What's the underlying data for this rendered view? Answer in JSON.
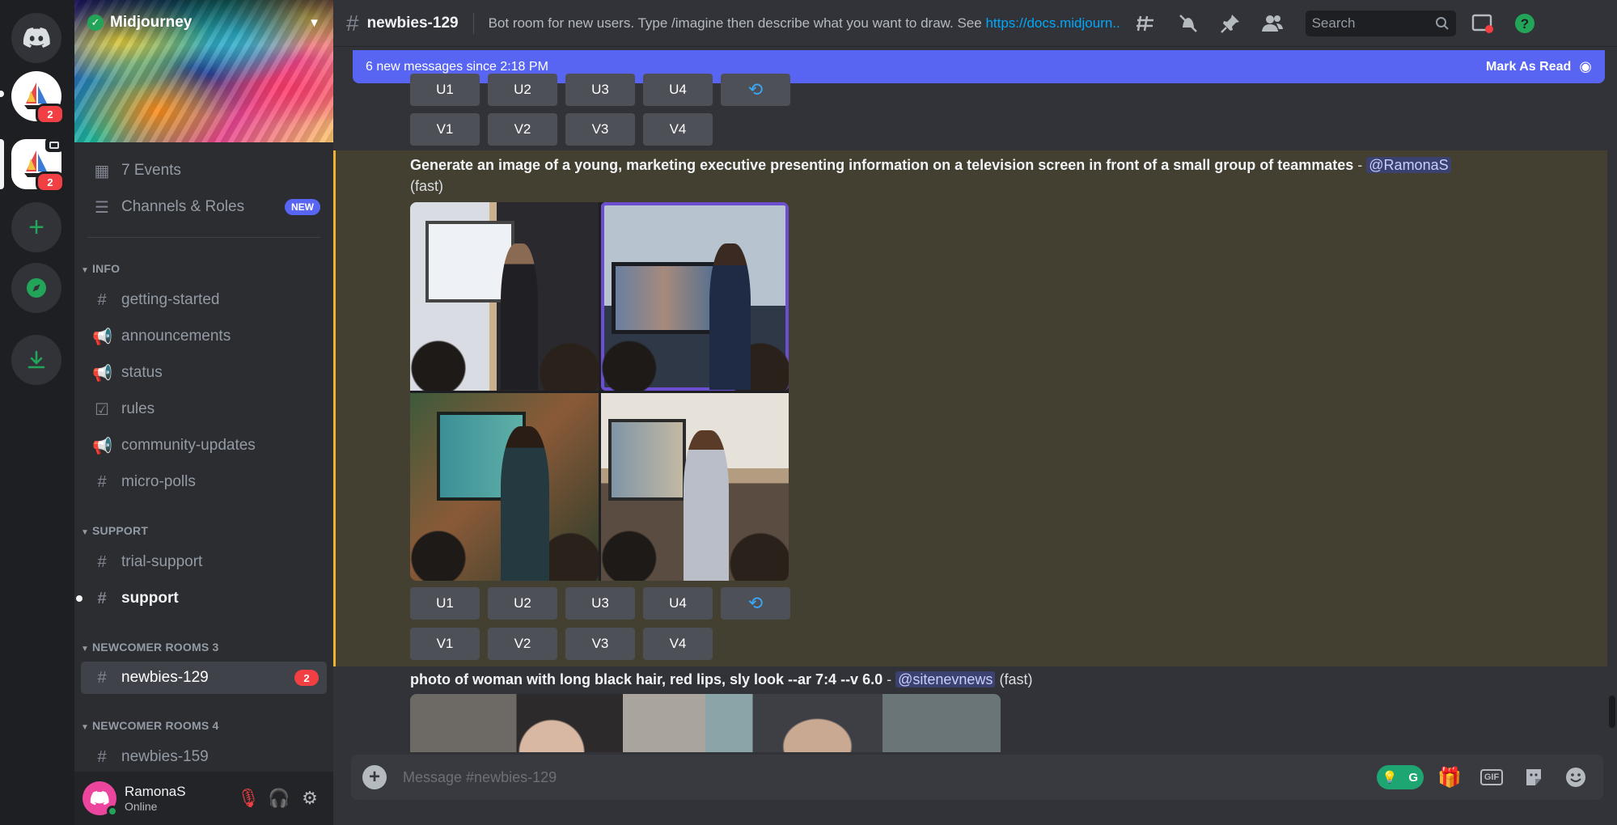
{
  "rail": {
    "servers": [
      {
        "name": "Discord Home",
        "icon": "discord-icon"
      },
      {
        "name": "Midjourney",
        "badge": "2"
      },
      {
        "name": "Midjourney 2",
        "badge": "2"
      },
      {
        "name": "Add a Server",
        "icon": "plus-icon"
      },
      {
        "name": "Explore",
        "icon": "compass-icon"
      },
      {
        "name": "Download Apps",
        "icon": "download-icon"
      }
    ]
  },
  "server": {
    "name": "Midjourney",
    "verified": true
  },
  "sidebar": {
    "events": "7 Events",
    "channels_roles": "Channels & Roles",
    "new_badge": "NEW",
    "categories": {
      "info": "INFO",
      "support": "SUPPORT",
      "newcomer3": "NEWCOMER ROOMS 3",
      "newcomer4": "NEWCOMER ROOMS 4"
    },
    "info_channels": [
      {
        "label": "getting-started",
        "icon": "hash-icon"
      },
      {
        "label": "announcements",
        "icon": "megaphone-icon"
      },
      {
        "label": "status",
        "icon": "megaphone-icon"
      },
      {
        "label": "rules",
        "icon": "rules-icon"
      },
      {
        "label": "community-updates",
        "icon": "megaphone-icon"
      },
      {
        "label": "micro-polls",
        "icon": "hash-icon"
      }
    ],
    "support_channels": [
      {
        "label": "trial-support"
      },
      {
        "label": "support"
      }
    ],
    "newcomer3_channels": [
      {
        "label": "newbies-129",
        "badge": "2"
      }
    ],
    "newcomer4_channels": [
      {
        "label": "newbies-159"
      }
    ]
  },
  "user": {
    "name": "RamonaS",
    "status": "Online"
  },
  "header": {
    "channel": "newbies-129",
    "topic": "Bot room for new users. Type /imagine then describe what you want to draw. See ",
    "topic_link": "https://docs.midjourn...",
    "search_placeholder": "Search"
  },
  "new_messages": {
    "label": "6 new messages since 2:18 PM",
    "action": "Mark As Read"
  },
  "buttons": {
    "upscale": [
      "U1",
      "U2",
      "U3",
      "U4"
    ],
    "variation": [
      "V1",
      "V2",
      "V3",
      "V4"
    ],
    "reroll": "⟲"
  },
  "messages": [
    {
      "prompt": "Generate an image of a young, marketing executive presenting information on a television screen in front of a small group of teammates",
      "separator": " - ",
      "mention": "@RamonaS",
      "mode": "(fast)"
    },
    {
      "prompt": "photo of woman with long black hair, red lips, sly look --ar 7:4 --v 6.0",
      "separator": " - ",
      "mention": "@sitenevnews",
      "mode": "(fast)"
    }
  ],
  "composer": {
    "placeholder": "Message #newbies-129",
    "gif": "GIF"
  },
  "colors": {
    "accent": "#5865f2",
    "highlight": "#433f31",
    "highlight_border": "#f0b232",
    "badge": "#f23f43",
    "online": "#23a559"
  }
}
